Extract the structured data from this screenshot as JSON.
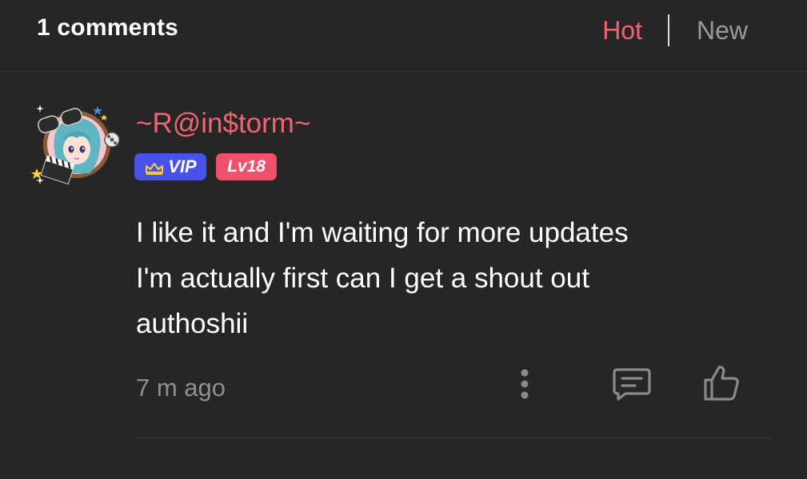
{
  "header": {
    "comment_count": "1 comments",
    "sort_hot": "Hot",
    "sort_new": "New",
    "active_sort": "Hot",
    "active_color": "#f2646f"
  },
  "comment": {
    "username": "~R@in$torm~",
    "username_color": "#f2646f",
    "vip_badge": "VIP",
    "vip_color": "#4753e8",
    "level_badge": "Lv18",
    "level_color": "#f0506a",
    "text_lines": [
      "I like it and I'm waiting for more updates",
      "I'm actually first can I get a shout out",
      "authoshii"
    ],
    "timestamp": "7 m ago",
    "actions": {
      "more_icon": "more-vertical-icon",
      "reply_icon": "comment-icon",
      "like_icon": "thumbs-up-icon"
    }
  }
}
